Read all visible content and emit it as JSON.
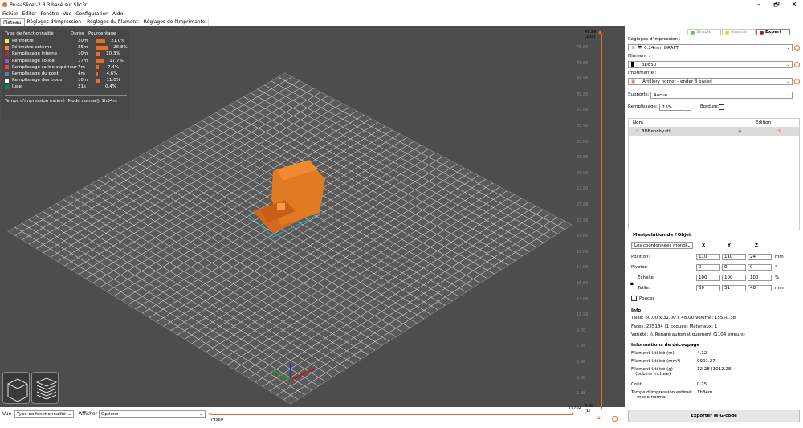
{
  "window": {
    "title": "PrusaSlicer-2.3.3 basé sur Slic3r",
    "min": "–",
    "max": "🗗",
    "close": "✕"
  },
  "menu": [
    "Fichier",
    "Editer",
    "Fenêtre",
    "Vue",
    "Configuration",
    "Aide"
  ],
  "tabs": [
    "Plateau",
    "Réglages d'Impression",
    "Réglages du filament",
    "Réglages de l'Imprimante"
  ],
  "legend": {
    "header": [
      "Type de fonctionnalité",
      "Durée",
      "Pourcentage"
    ],
    "rows": [
      {
        "name": "Périmètre",
        "time": "20m",
        "pct": "21.0%",
        "color": "#ffe64d",
        "frac": 0.21
      },
      {
        "name": "Périmètre externe",
        "time": "25m",
        "pct": "26.8%",
        "color": "#ff7d38",
        "frac": 0.268
      },
      {
        "name": "Remplissage interne",
        "time": "10m",
        "pct": "10.3%",
        "color": "#b03029",
        "frac": 0.103
      },
      {
        "name": "Remplissage solide",
        "time": "17m",
        "pct": "17.7%",
        "color": "#9654cc",
        "frac": 0.177
      },
      {
        "name": "Remplissage solide supérieur",
        "time": "7m",
        "pct": "7.4%",
        "color": "#f04040",
        "frac": 0.074
      },
      {
        "name": "Remplissage du pont",
        "time": "4m",
        "pct": "4.6%",
        "color": "#4d80ba",
        "frac": 0.046
      },
      {
        "name": "Remplissage des trous",
        "time": "10m",
        "pct": "11.0%",
        "color": "#ffffff",
        "frac": 0.11
      },
      {
        "name": "Jupe",
        "time": "21s",
        "pct": "0.4%",
        "color": "#00876e",
        "frac": 0.004
      }
    ],
    "estimate": "Temps d'impression estimé [Mode normal]:  1h34m"
  },
  "bottom": {
    "vue_label": "Vue",
    "vue_value": "Type de fonctionnalité",
    "afficher_label": "Afficher",
    "afficher_value": "Options",
    "h_left": "79560",
    "h_right": "79782"
  },
  "ruler": {
    "top": "47.96",
    "top_sub": "(200)",
    "bottom": "0.20",
    "bottom_sub": "(1)",
    "ticks": [
      "45.80",
      "43.88",
      "41.96",
      "39.80",
      "37.88",
      "35.96",
      "33.80",
      "31.88",
      "29.96",
      "27.80",
      "25.88",
      "23.96",
      "21.80",
      "19.88",
      "17.96",
      "15.80",
      "13.88",
      "11.96",
      "9.80",
      "7.88",
      "5.96",
      "3.80",
      "1.88"
    ]
  },
  "right": {
    "simple": "Simple",
    "avance": "Avancé",
    "expert": "Expert",
    "print_label": "Réglages d'impression :",
    "print_value": "0.24mm DRAFT",
    "fil_label": "Filament :",
    "fil_value": "3D850",
    "printer_label": "Imprimante :",
    "printer_value": "Artillery hornet - ender 3 based",
    "supports_label": "Supports:",
    "supports_value": "Aucun",
    "fill_label": "Remplissage:",
    "fill_value": "15%",
    "bordure_label": "Bordure:",
    "col_name": "Nom",
    "col_edit": "Édition",
    "object": "3DBenchy.stl",
    "manip_title": "Manipulation de l'Objet",
    "coord": "Les coordonnées mondi",
    "x": "X",
    "y": "Y",
    "z": "Z",
    "pos_label": "Position:",
    "pos": [
      "110",
      "110",
      "24"
    ],
    "mm": "mm",
    "rot_label": "Pivoter:",
    "rot": [
      "0",
      "0",
      "0"
    ],
    "deg": "°",
    "scale_label": "Échelle:",
    "scale": [
      "100",
      "100",
      "100"
    ],
    "pct": "%",
    "size_label": "Taille:",
    "size": [
      "60",
      "31",
      "48"
    ],
    "mm2": "mm",
    "pouces": "Pouces",
    "info_title": "Info",
    "taille": "Taille:  60.00 x 31.00 x 48.00   Volume:     15550.38",
    "faces": "Faces:  225134 (1 coques)     Matériaux:   1",
    "variete": "Variété: ⚠ Réparé automatiquement (1104 erreurs)",
    "slice_title": "Informations de découpage",
    "slice": [
      [
        "Filament Utilisé (m)",
        "4.12"
      ],
      [
        "Filament Utilisé (mm³)",
        "9901.27"
      ],
      [
        "Filament Utilisé (g)\n   (bobine incluse)",
        "12.28 (1012.28)"
      ],
      [
        "Coût",
        "0.25"
      ],
      [
        "Temps d'impression estimé:\n  - mode normal",
        "1h34m"
      ]
    ],
    "export": "Exporter le G-code"
  }
}
